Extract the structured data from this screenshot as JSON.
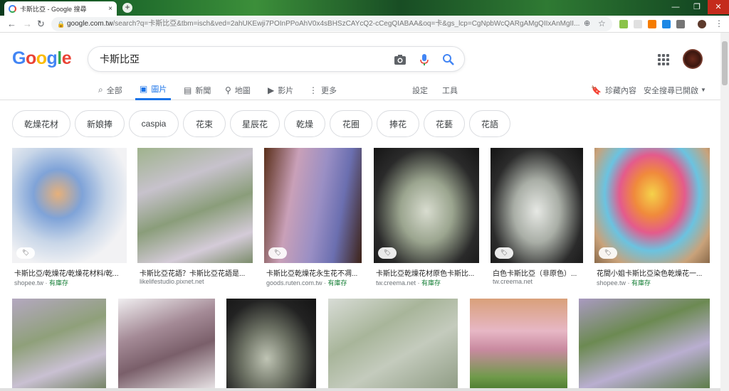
{
  "browser": {
    "tab_title": "卡斯比亞 - Google 搜尋",
    "tab_close": "×",
    "new_tab": "+",
    "url_host": "google.com.tw",
    "url_path": "/search?q=卡斯比亞&tbm=isch&ved=2ahUKEwji7POInPPoAhV0x4sBHSzCAYcQ2-cCegQIABAA&oq=卡&gs_lcp=CgNpbWcQARgAMgQIIxAnMgII...",
    "window_buttons": [
      "—",
      "❐",
      "✕"
    ]
  },
  "google": {
    "logo": [
      "G",
      "o",
      "o",
      "g",
      "l",
      "e"
    ],
    "logo_colors": [
      "#4285f4",
      "#ea4335",
      "#fbbc05",
      "#4285f4",
      "#34a853",
      "#ea4335"
    ],
    "query": "卡斯比亞",
    "tabs": [
      {
        "label": "全部",
        "icon": "search-icon"
      },
      {
        "label": "圖片",
        "icon": "image-icon"
      },
      {
        "label": "新聞",
        "icon": "news-icon"
      },
      {
        "label": "地圖",
        "icon": "map-pin-icon"
      },
      {
        "label": "影片",
        "icon": "video-icon"
      },
      {
        "label": "更多",
        "icon": "more-icon"
      }
    ],
    "settings": "設定",
    "tools": "工具",
    "saved": "珍藏內容",
    "safesearch": "安全搜尋已開啟",
    "chips": [
      "乾燥花材",
      "新娘捧",
      "caspia",
      "花束",
      "星辰花",
      "乾燥",
      "花圈",
      "捧花",
      "花藝",
      "花語"
    ]
  },
  "results": [
    {
      "title": "卡斯比亞/乾燥花/乾燥花材料/乾...",
      "source": "shopee.tw",
      "stock": "有庫存"
    },
    {
      "title": "卡斯比亞花語？卡斯比亞花語是...",
      "source": "likelifestudio.pixnet.net",
      "stock": ""
    },
    {
      "title": "卡斯比亞乾燥花永生花不凋...",
      "source": "goods.ruten.com.tw",
      "stock": "有庫存"
    },
    {
      "title": "卡斯比亞乾燥花材原色卡斯比...",
      "source": "tw.creema.net",
      "stock": "有庫存"
    },
    {
      "title": "白色卡斯比亞（非原色）...",
      "source": "tw.creema.net",
      "stock": ""
    },
    {
      "title": "花間小姐卡斯比亞染色乾燥花一...",
      "source": "shopee.tw",
      "stock": "有庫存"
    }
  ],
  "result_tag": "🏷",
  "source_sep": " · "
}
